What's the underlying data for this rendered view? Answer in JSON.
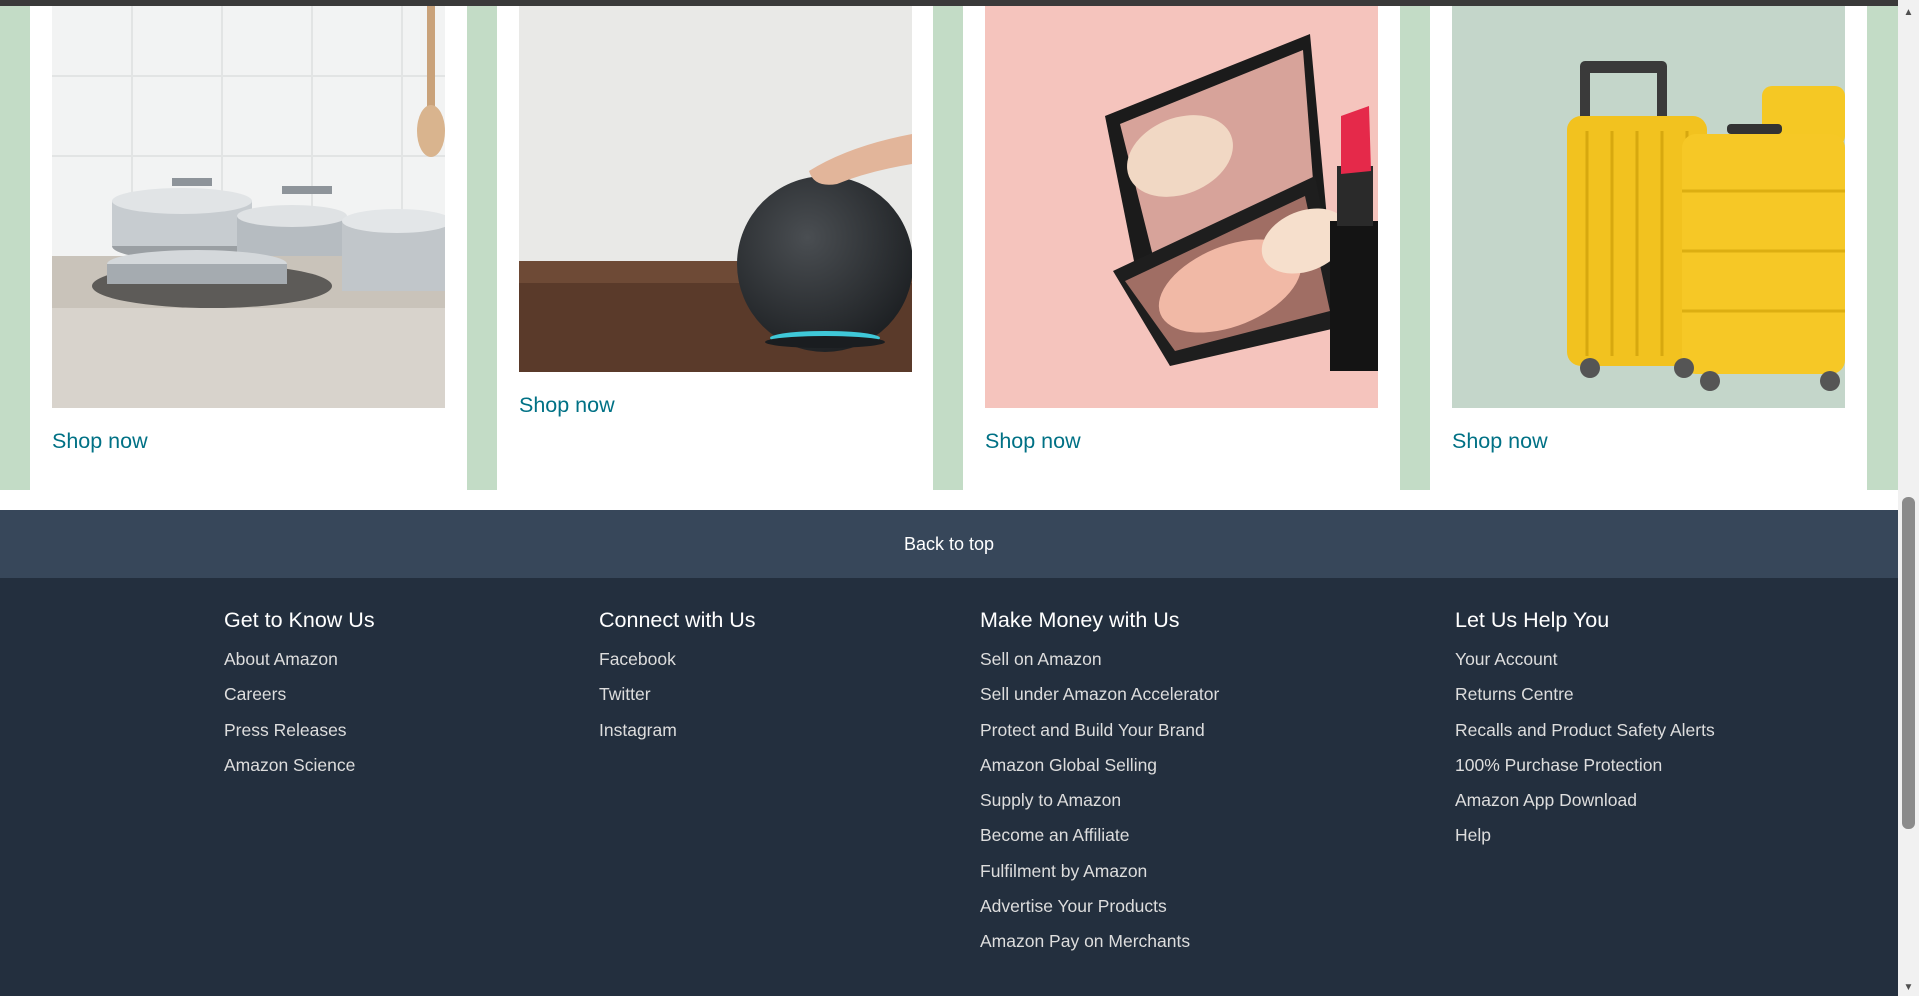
{
  "products": [
    {
      "name": "cookware",
      "link": "Shop now"
    },
    {
      "name": "smart-speaker",
      "link": "Shop now"
    },
    {
      "name": "makeup-compact",
      "link": "Shop now"
    },
    {
      "name": "luggage",
      "link": "Shop now"
    }
  ],
  "back_to_top": "Back to top",
  "footer": {
    "columns": [
      {
        "title": "Get to Know Us",
        "links": [
          "About Amazon",
          "Careers",
          "Press Releases",
          "Amazon Science"
        ]
      },
      {
        "title": "Connect with Us",
        "links": [
          "Facebook",
          "Twitter",
          "Instagram"
        ]
      },
      {
        "title": "Make Money with Us",
        "links": [
          "Sell on Amazon",
          "Sell under Amazon Accelerator",
          "Protect and Build Your Brand",
          "Amazon Global Selling",
          "Supply to Amazon",
          "Become an Affiliate",
          "Fulfilment by Amazon",
          "Advertise Your Products",
          "Amazon Pay on Merchants"
        ]
      },
      {
        "title": "Let Us Help You",
        "links": [
          "Your Account",
          "Returns Centre",
          "Recalls and Product Safety Alerts",
          "100% Purchase Protection",
          "Amazon App Download",
          "Help"
        ]
      }
    ]
  },
  "colors": {
    "link": "#007185",
    "band": "#c3dcc6",
    "back_to_top_bg": "#37475a",
    "footer_bg": "#232f3e"
  }
}
